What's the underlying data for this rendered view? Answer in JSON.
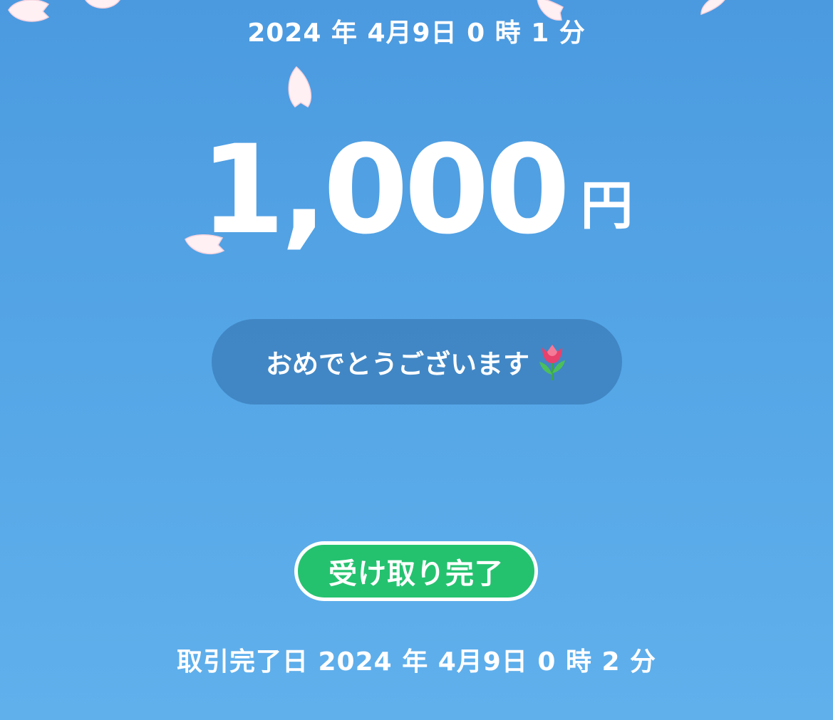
{
  "transfer": {
    "sent_datetime": "2024 年 4月9日 0 時 1 分",
    "amount": "1,000",
    "currency_unit": "円",
    "message": "おめでとうございます",
    "message_icon": "tulip-icon",
    "status_label": "受け取り完了",
    "completed_datetime": "取引完了日 2024 年 4月9日 0 時 2 分"
  },
  "colors": {
    "background_top": "#4b9ae0",
    "background_bottom": "#60b0ec",
    "status_badge": "#24c26f",
    "petal": "#fff0f4"
  },
  "decorations": {
    "petal_icon": "cherry-blossom-petal-icon"
  }
}
